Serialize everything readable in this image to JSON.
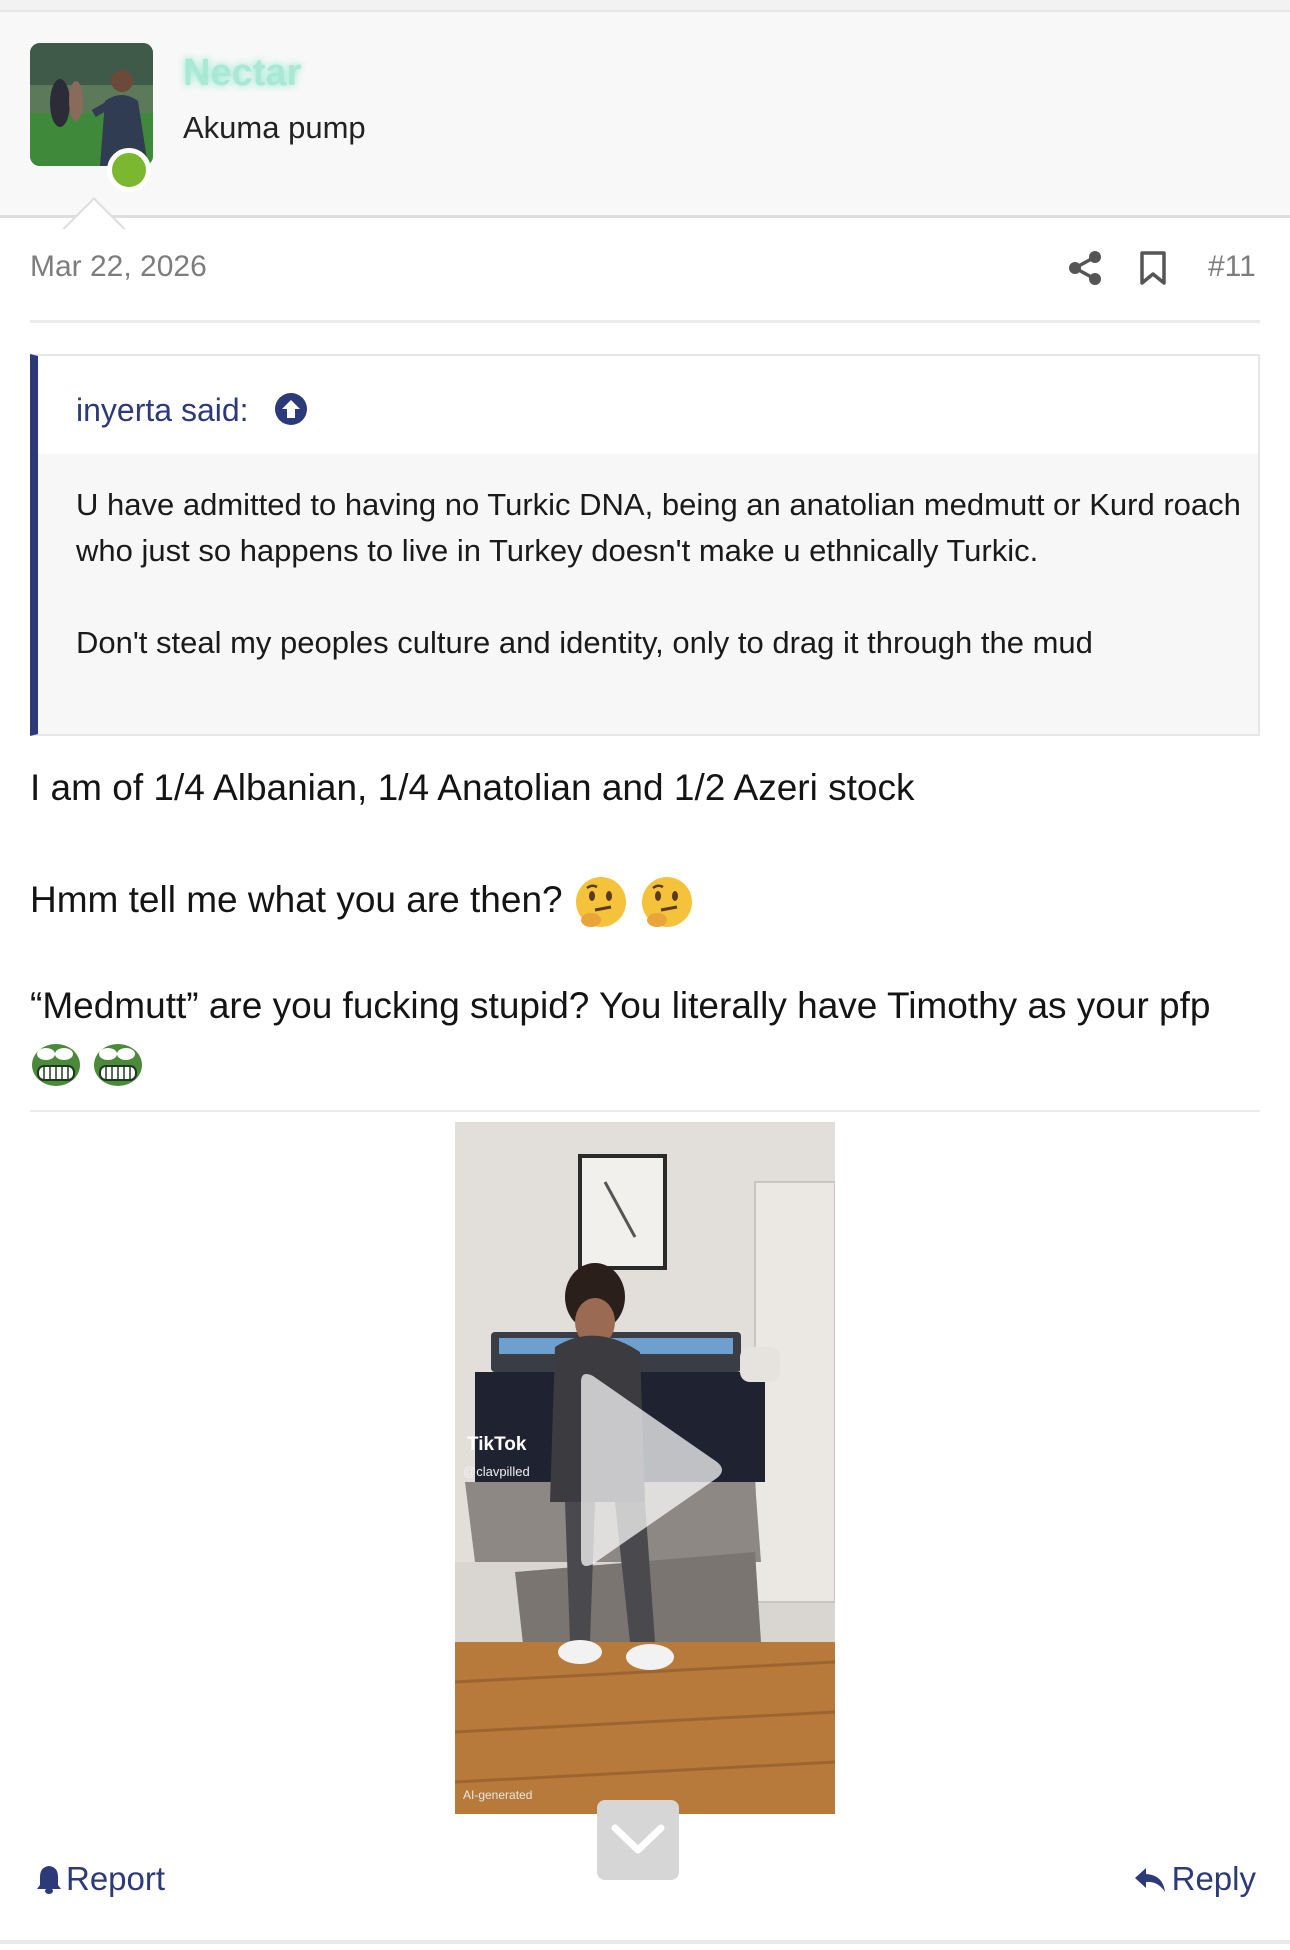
{
  "post": {
    "username": "Nectar",
    "user_title": "Akuma pump",
    "date": "Mar 22, 2026",
    "post_number": "#11"
  },
  "quote": {
    "author": "inyerta said:",
    "paragraphs": [
      "U have admitted to having no Turkic DNA, being an anatolian medmutt or Kurd roach who just so happens to live in Turkey doesn't make u ethnically Turkic.",
      "Don't steal my peoples culture and identity, only to drag it through the mud"
    ]
  },
  "body": {
    "line1": "I am of 1/4 Albanian, 1/4 Anatolian and 1/2 Azeri stock",
    "line2": "Hmm tell me what you are then?",
    "line3": "“Medmutt” are you fucking stupid? You literally have Timothy as your pfp"
  },
  "video": {
    "platform": "TikTok",
    "handle": "@clavpilled",
    "ai_label": "AI-generated"
  },
  "actions": {
    "report": "Report",
    "reply": "Reply"
  },
  "icons": [
    "share-icon",
    "bookmark-icon",
    "quote-jump-icon",
    "thinking-face-emoji",
    "pepe-grin-emoji",
    "play-icon",
    "chevron-down-icon",
    "bell-icon",
    "reply-icon"
  ],
  "colors": {
    "username": "#a9e9d3",
    "accent": "#2d3a7a",
    "online": "#7cb82f",
    "meta": "#7d7d7d"
  }
}
